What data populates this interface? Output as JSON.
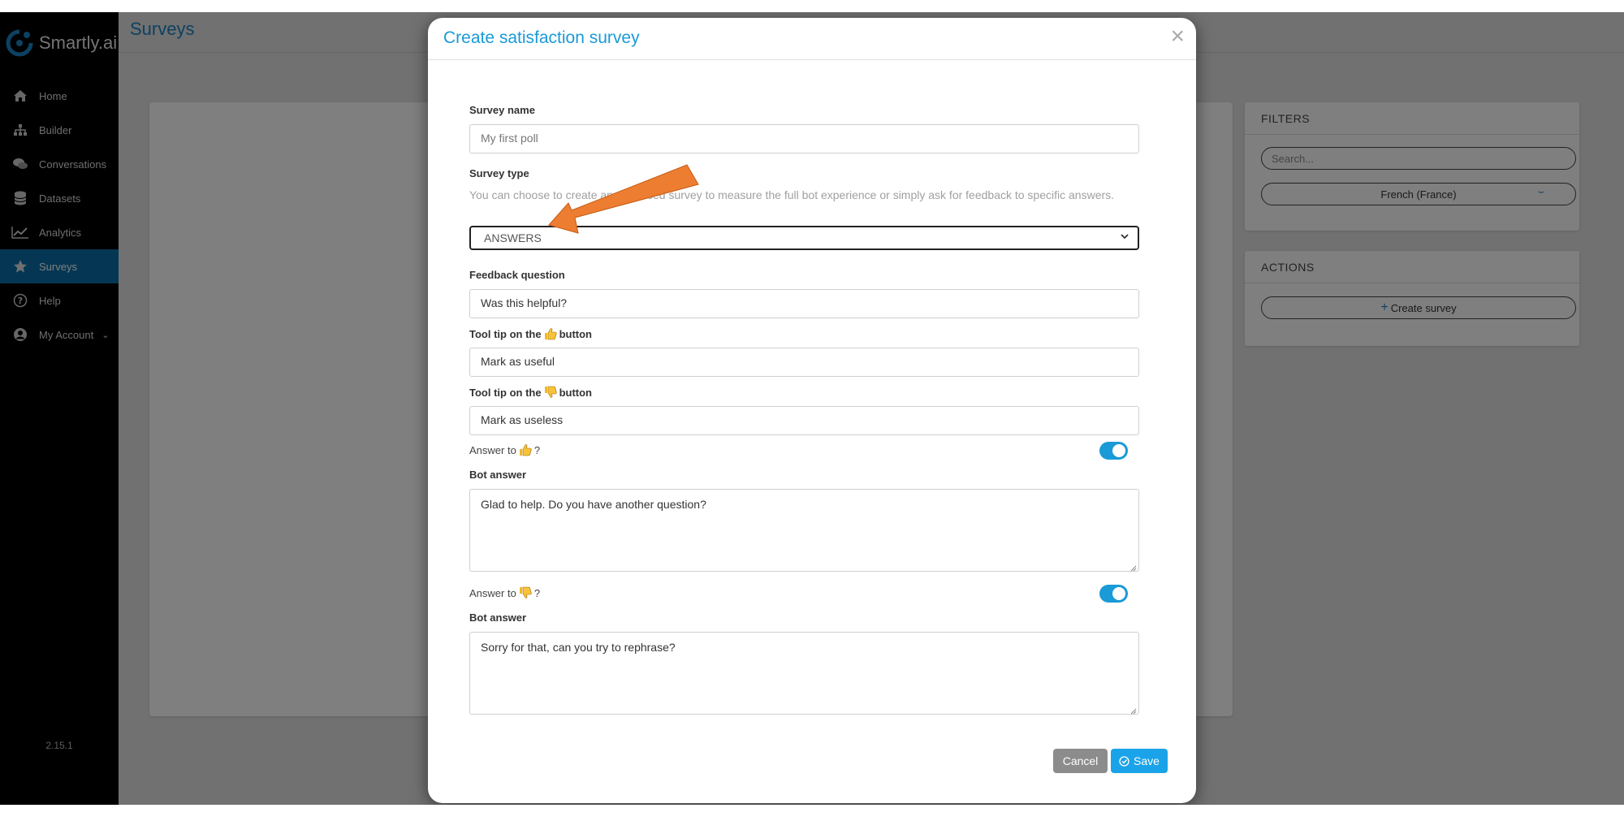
{
  "app": {
    "name": "Smartly.ai",
    "version": "2.15.1"
  },
  "sidebar": {
    "items": [
      {
        "label": "Home",
        "icon": "home-icon"
      },
      {
        "label": "Builder",
        "icon": "sitemap-icon"
      },
      {
        "label": "Conversations",
        "icon": "chat-icon"
      },
      {
        "label": "Datasets",
        "icon": "database-icon"
      },
      {
        "label": "Analytics",
        "icon": "chart-line-icon"
      },
      {
        "label": "Surveys",
        "icon": "star-icon",
        "active": true
      },
      {
        "label": "Help",
        "icon": "help-icon"
      },
      {
        "label": "My Account",
        "icon": "user-icon"
      }
    ]
  },
  "header": {
    "title": "Surveys"
  },
  "filters": {
    "title": "FILTERS",
    "search_placeholder": "Search...",
    "language": "French (France)"
  },
  "actions": {
    "title": "ACTIONS",
    "create_label": "Create survey"
  },
  "modal": {
    "title": "Create satisfaction survey",
    "close": "×",
    "survey_name_label": "Survey name",
    "survey_name_value": "My first poll",
    "survey_type_label": "Survey type",
    "survey_type_hint": "You can choose to create an advanced survey to measure the full bot experience or simply ask for feedback to specific answers.",
    "survey_type_value": "ANSWERS",
    "feedback_question_label": "Feedback question",
    "feedback_question_value": "Was this helpful?",
    "tooltip_up_prefix": "Tool tip on the",
    "tooltip_up_suffix": "button",
    "tooltip_up_value": "Mark as useful",
    "tooltip_down_prefix": "Tool tip on the",
    "tooltip_down_suffix": "button",
    "tooltip_down_value": "Mark as useless",
    "answer_up_prefix": "Answer to",
    "answer_up_suffix": "?",
    "answer_up_enabled": true,
    "bot_answer_up_label": "Bot answer",
    "bot_answer_up_value": "Glad to help. Do you have another question?",
    "answer_down_prefix": "Answer to",
    "answer_down_suffix": "?",
    "answer_down_enabled": true,
    "bot_answer_down_label": "Bot answer",
    "bot_answer_down_value": "Sorry for that, can you try to rephrase?",
    "cancel_label": "Cancel",
    "save_label": "Save"
  },
  "colors": {
    "accent": "#1a9ad6",
    "sidebar_active": "#0b6ea8",
    "annotation_arrow": "#ed7d31"
  }
}
